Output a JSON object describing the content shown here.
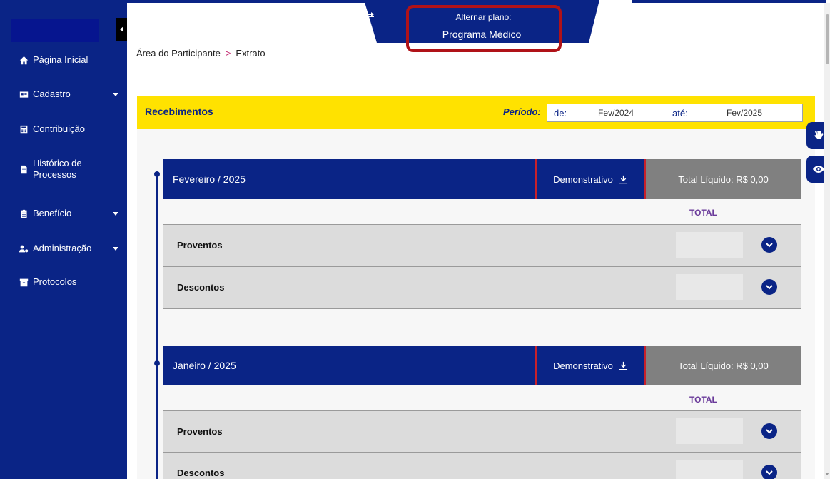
{
  "sidebar": {
    "items": [
      {
        "label": "Página Inicial",
        "icon": "home-icon",
        "has_caret": false
      },
      {
        "label": "Cadastro",
        "icon": "id-card-icon",
        "has_caret": true
      },
      {
        "label": "Contribuição",
        "icon": "calculator-icon",
        "has_caret": false
      },
      {
        "label": "Histórico de Processos",
        "icon": "document-icon",
        "has_caret": false
      },
      {
        "label": "Benefício",
        "icon": "clipboard-icon",
        "has_caret": true
      },
      {
        "label": "Administração",
        "icon": "users-cog-icon",
        "has_caret": true
      },
      {
        "label": "Protocolos",
        "icon": "archive-icon",
        "has_caret": false
      }
    ]
  },
  "plan": {
    "label": "Alternar plano:",
    "value": "Programa Médico"
  },
  "breadcrumb": {
    "root": "Área do Participante",
    "separator": ">",
    "current": "Extrato"
  },
  "panel": {
    "title": "Recebimentos",
    "period_label": "Período:",
    "from_label": "de:",
    "from_value": "Fev/2024",
    "to_label": "até:",
    "to_value": "Fev/2025"
  },
  "months": [
    {
      "name": "Fevereiro / 2025",
      "demo_label": "Demonstrativo",
      "total_label": "Total Líquido: R$ 0,00",
      "total_header": "TOTAL",
      "rows": [
        {
          "label": "Proventos"
        },
        {
          "label": "Descontos"
        }
      ]
    },
    {
      "name": "Janeiro / 2025",
      "demo_label": "Demonstrativo",
      "total_label": "Total Líquido: R$ 0,00",
      "total_header": "TOTAL",
      "rows": [
        {
          "label": "Proventos"
        },
        {
          "label": "Descontos"
        }
      ]
    }
  ],
  "colors": {
    "primary": "#0a2486",
    "header_yellow": "#ffe200",
    "highlight_red": "#b01218",
    "total_purple": "#6a3a9a"
  }
}
